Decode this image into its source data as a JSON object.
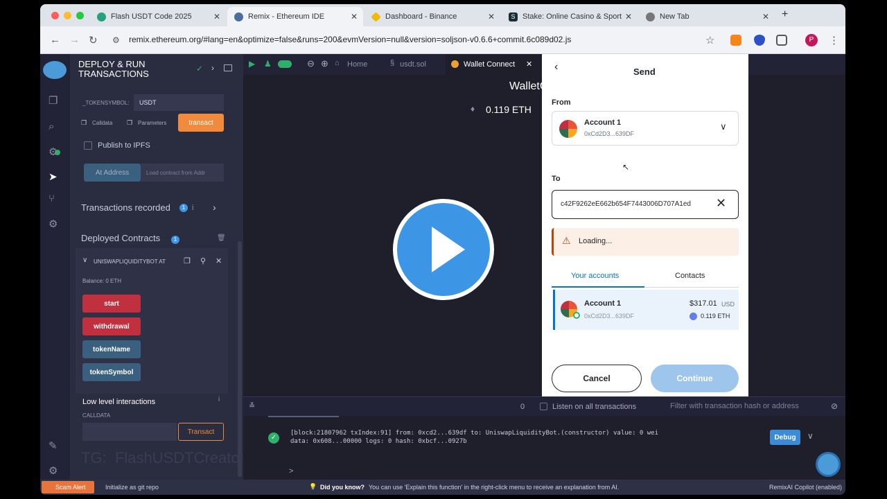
{
  "browser": {
    "tabs": [
      {
        "title": "Flash USDT Code 2025",
        "favicon_color": "#26a17b"
      },
      {
        "title": "Remix - Ethereum IDE",
        "favicon_color": "#4a6f9c"
      },
      {
        "title": "Dashboard - Binance",
        "favicon_color": "#f0b90b"
      },
      {
        "title": "Stake: Online Casino & Sport",
        "favicon_color": "#1a2c38"
      },
      {
        "title": "New Tab",
        "favicon_color": "#777777"
      }
    ],
    "url": "remix.ethereum.org/#lang=en&optimize=false&runs=200&evmVersion=null&version=soljson-v0.6.6+commit.6c089d02.js",
    "profile_initial": "P"
  },
  "remix": {
    "panel_title_1": "DEPLOY & RUN",
    "panel_title_2": "TRANSACTIONS",
    "token_symbol_label": "_TOKENSYMBOL:",
    "token_symbol_value": "USDT",
    "calldata_label": "Calldata",
    "parameters_label": "Parameters",
    "transact_label": "transact",
    "publish_ipfs": "Publish to IPFS",
    "at_address": "At Address",
    "load_contract": "Load contract from Addr",
    "transactions_recorded": "Transactions recorded",
    "transactions_count": "1",
    "deployed_contracts": "Deployed Contracts",
    "deployed_count": "1",
    "contract_name": "UNISWAPLIQUIDITYBOT AT",
    "balance": "Balance: 0 ETH",
    "functions": [
      {
        "label": "start",
        "color": "#c0303f"
      },
      {
        "label": "withdrawal",
        "color": "#c0303f"
      },
      {
        "label": "tokenName",
        "color": "#3b5f7e"
      },
      {
        "label": "tokenSymbol",
        "color": "#3b5f7e"
      }
    ],
    "low_level": "Low level interactions",
    "calldata_caps": "CALLDATA",
    "transact_btn": "Transact",
    "watermark": "TG:  FlashUSDTCreator",
    "tabs": [
      "Home",
      "usdt.sol",
      "Wallet Connect"
    ],
    "wallet_title": "WalletC",
    "eth_balance": "0.119 ETH",
    "term_count": "0",
    "listen_label": "Listen on all transactions",
    "filter_placeholder": "Filter with transaction hash or address",
    "log_line1": "[block:21807962 txIndex:91] from: 0xcd2...639df to: UniswapLiquidityBot.(constructor) value: 0 wei",
    "log_line2": "data: 0x608...00000 logs: 0 hash: 0xbcf...0927b",
    "debug_label": "Debug",
    "prompt": ">",
    "status_scam": "Scam Alert",
    "status_git": "Initialize as git repo",
    "status_did_you_know": "Did you know?",
    "status_tip": "You can use 'Explain this function' in the right-click menu to receive an explanation from AI.",
    "status_copilot": "RemixAI Copilot (enabled)"
  },
  "metamask": {
    "title": "Send",
    "from_label": "From",
    "account_name": "Account 1",
    "account_address": "0xCd2D3...639DF",
    "to_label": "To",
    "to_value": "c42F9262eE662b654F7443006D707A1ed",
    "loading_text": "Loading...",
    "tab_accounts": "Your accounts",
    "tab_contacts": "Contacts",
    "row_account_name": "Account 1",
    "row_address": "0xCd2D3...639DF",
    "row_usd": "$317.01",
    "row_usd_unit": "USD",
    "row_eth": "0.119 ETH",
    "cancel": "Cancel",
    "continue": "Continue"
  }
}
